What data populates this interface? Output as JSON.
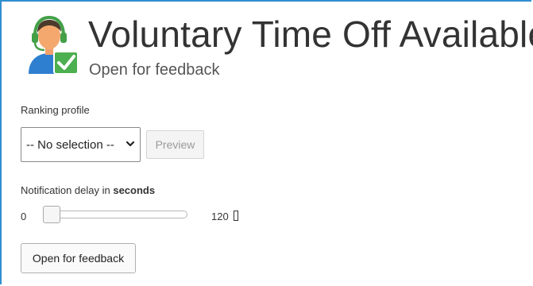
{
  "header": {
    "title": "Voluntary Time Off Available",
    "subtitle": "Open for feedback",
    "avatar_icon": "agent-headset-checkmark-icon"
  },
  "ranking": {
    "label": "Ranking profile",
    "select_value": "-- No selection --",
    "preview_label": "Preview"
  },
  "notification": {
    "label_prefix": "Notification delay in ",
    "label_bold": "seconds",
    "slider_min": "0",
    "slider_max": "120",
    "slider_value": 0
  },
  "actions": {
    "open_feedback_label": "Open for feedback"
  },
  "colors": {
    "frame_border": "#2f8fd0",
    "check_green": "#4caf50",
    "headset_green": "#43a047"
  }
}
